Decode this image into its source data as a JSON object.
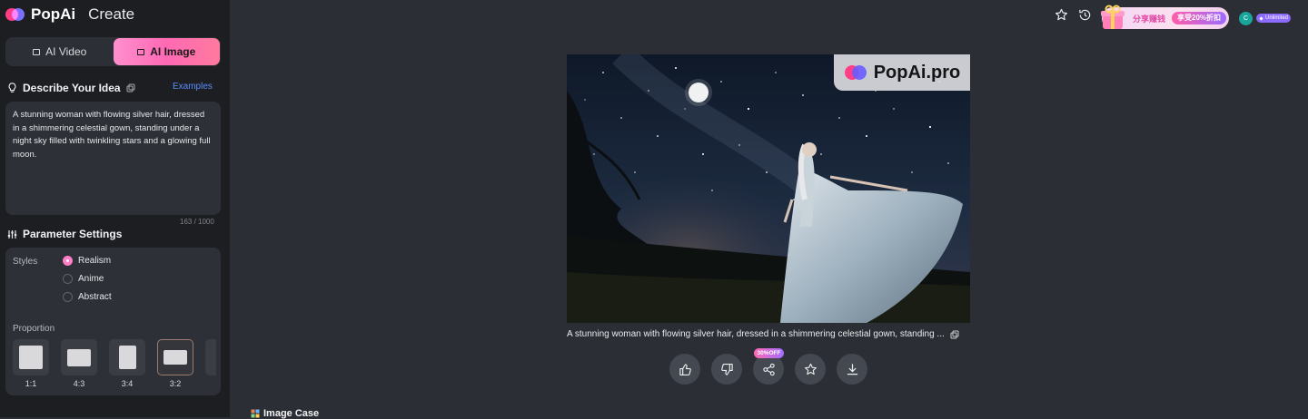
{
  "brand": {
    "name": "PopAi",
    "section": "Create"
  },
  "mode_tabs": [
    {
      "label": "AI Video",
      "active": false,
      "icon": "video-icon"
    },
    {
      "label": "AI Image",
      "active": true,
      "icon": "image-icon"
    }
  ],
  "describe": {
    "heading": "Describe Your Idea",
    "examples_link": "Examples",
    "prompt": "A stunning woman with flowing silver hair, dressed in a shimmering celestial gown, standing under a night sky filled with twinkling stars and a glowing full moon.",
    "counter": "163 / 1000"
  },
  "params": {
    "heading": "Parameter Settings",
    "styles_label": "Styles",
    "styles": [
      {
        "label": "Realism",
        "selected": true
      },
      {
        "label": "Anime",
        "selected": false
      },
      {
        "label": "Abstract",
        "selected": false
      }
    ],
    "proportion_label": "Proportion",
    "proportions": [
      {
        "label": "1:1",
        "selected": false
      },
      {
        "label": "4:3",
        "selected": false
      },
      {
        "label": "3:4",
        "selected": false
      },
      {
        "label": "3:2",
        "selected": true
      }
    ]
  },
  "topbar": {
    "promo_text": "分享赚钱",
    "promo_badge": "享受20%折扣",
    "avatar_letter": "C",
    "plan": "Unlimited"
  },
  "result": {
    "watermark": "PopAi.pro",
    "caption": "A stunning woman with flowing silver hair, dressed in a shimmering celestial gown, standing ...",
    "share_badge": "30%OFF"
  },
  "actions": [
    "like",
    "dislike",
    "share",
    "favorite",
    "download"
  ],
  "section_below": "Image Case",
  "colors": {
    "accent_pink": "#ff69b4",
    "link_blue": "#5b8cff",
    "bg": "#2b2e35",
    "sidebar": "#1c1e22"
  }
}
